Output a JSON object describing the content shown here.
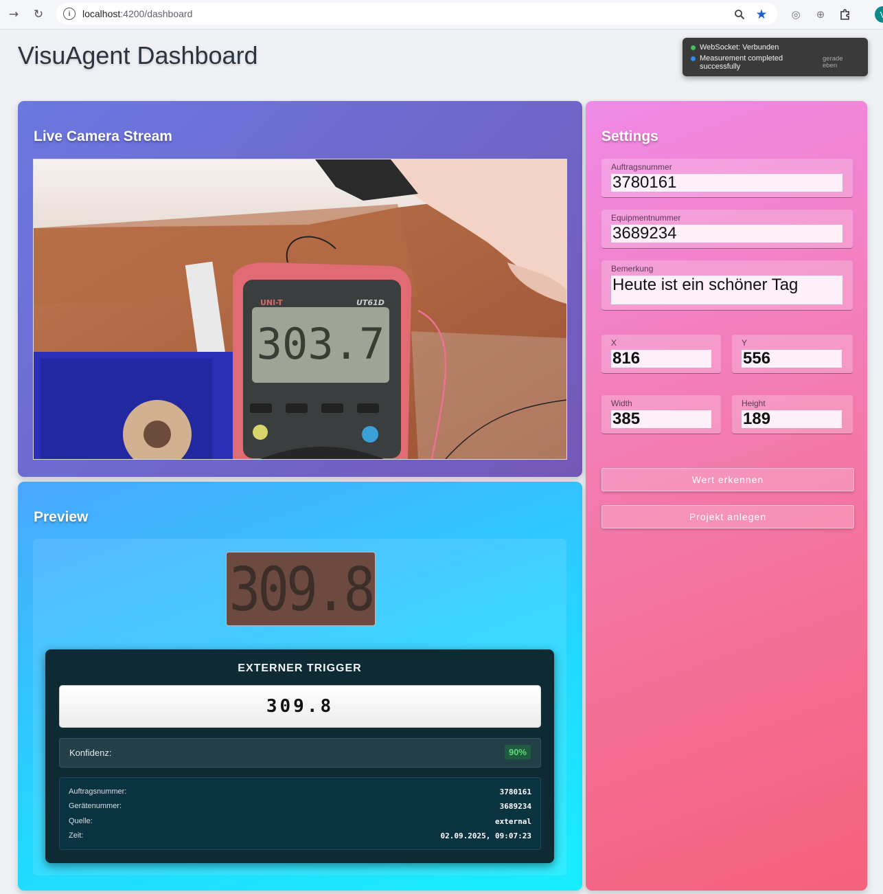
{
  "browser": {
    "url_host": "localhost",
    "url_path": ":4200/dashboard"
  },
  "page": {
    "title": "VisuAgent Dashboard"
  },
  "toast": {
    "status": "WebSocket: Verbunden",
    "message": "Measurement completed successfully",
    "time": "gerade eben",
    "status_color": "#3ec15a",
    "message_color": "#2d8df0"
  },
  "camera": {
    "title": "Live Camera Stream",
    "meter_brand": "UNI-T",
    "meter_model": "UT61D",
    "meter_reading": "303.7"
  },
  "preview": {
    "title": "Preview",
    "crop_reading": "309.8",
    "trigger": {
      "title": "EXTERNER TRIGGER",
      "value": "309.8",
      "confidence_label": "Konfidenz:",
      "confidence": "90%",
      "info": [
        {
          "label": "Auftragsnummer:",
          "value": "3780161"
        },
        {
          "label": "Gerätenummer:",
          "value": "3689234"
        },
        {
          "label": "Quelle:",
          "value": "external"
        },
        {
          "label": "Zeit:",
          "value": "02.09.2025, 09:07:23"
        }
      ]
    }
  },
  "settings": {
    "title": "Settings",
    "auftragsnummer": {
      "label": "Auftragsnummer",
      "value": "3780161"
    },
    "equipmentnummer": {
      "label": "Equipmentnummer",
      "value": "3689234"
    },
    "bemerkung": {
      "label": "Bemerkung",
      "value": "Heute ist ein schöner Tag"
    },
    "x": {
      "label": "X",
      "value": "816"
    },
    "y": {
      "label": "Y",
      "value": "556"
    },
    "width": {
      "label": "Width",
      "value": "385"
    },
    "height": {
      "label": "Height",
      "value": "189"
    },
    "detect_button": "Wert erkennen",
    "create_button": "Projekt anlegen"
  }
}
